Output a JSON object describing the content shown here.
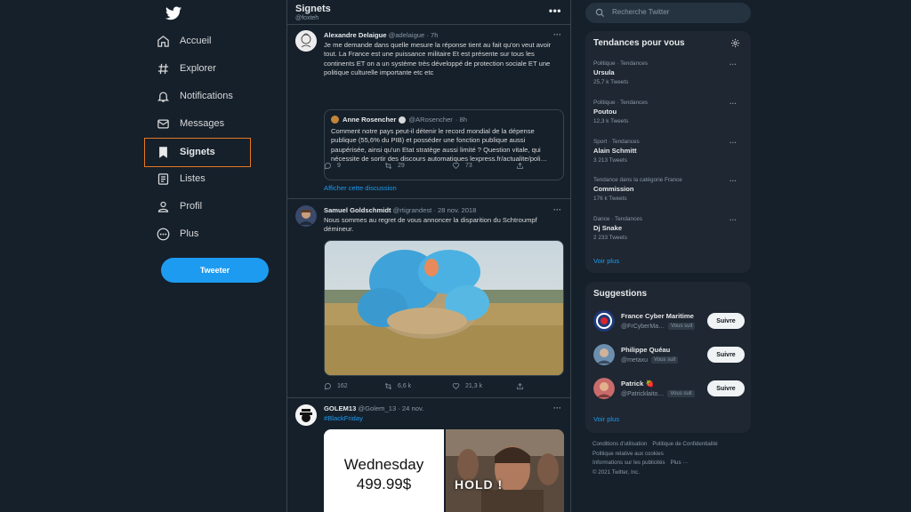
{
  "app": {
    "brand_color": "#1d9bf0",
    "active_outline_color": "#e87722",
    "logo": "twitter-bird-icon"
  },
  "nav": {
    "items": [
      {
        "label": "Accueil",
        "icon": "home-icon"
      },
      {
        "label": "Explorer",
        "icon": "hashtag-icon"
      },
      {
        "label": "Notifications",
        "icon": "bell-icon"
      },
      {
        "label": "Messages",
        "icon": "envelope-icon"
      },
      {
        "label": "Signets",
        "icon": "bookmark-icon",
        "active": true
      },
      {
        "label": "Listes",
        "icon": "list-icon"
      },
      {
        "label": "Profil",
        "icon": "person-icon"
      },
      {
        "label": "Plus",
        "icon": "more-circle-icon"
      }
    ],
    "tweet_button": "Tweeter"
  },
  "main": {
    "title": "Signets",
    "handle": "@foxteh",
    "more": "•••",
    "tweets": [
      {
        "name": "Alexandre Delaigue",
        "handle": "@adelaigue",
        "time": "· 7h",
        "text": "Je me demande dans quelle mesure la réponse tient au fait qu'on veut avoir tout. La France est une puissance militaire Et est présente sur tous les continents ET on a un système très développé de protection sociale ET une politique culturelle importante etc etc",
        "quote": {
          "name": "Anne Rosencher",
          "handle": "@ARosencher",
          "time": "· 8h",
          "text": "Comment notre pays peut-il détenir le record mondial de la dépense publique (55,6% du PIB) et posséder une fonction publique aussi paupérisée, ainsi qu'un Etat stratège aussi limité ? Question vitale, qui nécessite de sortir des discours automatiques lexpress.fr/actualite/poli…"
        },
        "replies": "9",
        "retweets": "29",
        "likes": "73",
        "show_thread": "Afficher cette discussion"
      },
      {
        "name": "Samuel Goldschmidt",
        "handle": "@rtigrandest",
        "time": "· 28 nov. 2018",
        "text": "Nous sommes au regret de vous annoncer la disparition du Schtroumpf démineur.",
        "replies": "162",
        "retweets": "6,6 k",
        "likes": "21,3 k"
      },
      {
        "name": "GOLEM13",
        "handle": "@Golem_13",
        "time": "· 24 nov.",
        "hashtag": "#BlackFriday",
        "meme_line1": "Wednesday",
        "meme_line2": "499.99$",
        "meme_right": "HOLD !"
      }
    ]
  },
  "search": {
    "placeholder": "Recherche Twitter"
  },
  "trends": {
    "title": "Tendances pour vous",
    "items": [
      {
        "category": "Politique · Tendances",
        "name": "Ursula",
        "count": "25,7 k Tweets"
      },
      {
        "category": "Politique · Tendances",
        "name": "Poutou",
        "count": "12,3 k Tweets"
      },
      {
        "category": "Sport · Tendances",
        "name": "Alain Schmitt",
        "count": "3 213 Tweets"
      },
      {
        "category": "Tendance dans la catégorie France",
        "name": "Commission",
        "count": "176 k Tweets"
      },
      {
        "category": "Dance · Tendances",
        "name": "Dj Snake",
        "count": "2 233 Tweets"
      }
    ],
    "more_link": "Voir plus"
  },
  "suggestions": {
    "title": "Suggestions",
    "items": [
      {
        "name": "France Cyber Maritime",
        "handle": "@FrCyberMa…",
        "badge": "Vous suit",
        "button": "Suivre"
      },
      {
        "name": "Philippe Quéau",
        "handle": "@metaxu",
        "badge": "Vous suit",
        "button": "Suivre"
      },
      {
        "name": "Patrick 🍓",
        "handle": "@Patricklaito…",
        "badge": "Vous suit",
        "button": "Suivre"
      }
    ],
    "more_link": "Voir plus"
  },
  "footer": {
    "links": [
      "Conditions d'utilisation",
      "Politique de Confidentialité",
      "Politique relative aux cookies",
      "Informations sur les publicités",
      "Plus ···"
    ],
    "copyright": "© 2021 Twitter, Inc."
  }
}
